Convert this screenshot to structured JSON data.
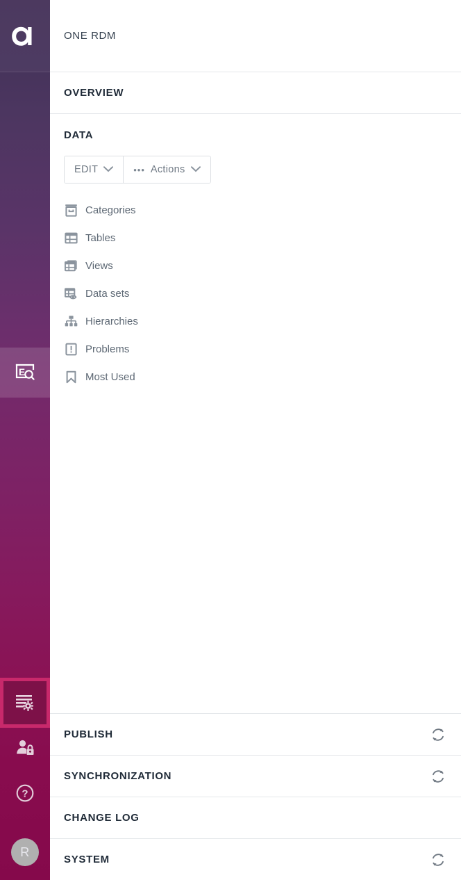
{
  "app": {
    "title": "ONE RDM",
    "logo_icon": "letter-a-logo"
  },
  "colors": {
    "rail_top": "#443158",
    "rail_bottom": "#85094b",
    "accent_pink": "#c8296b",
    "section_text": "#1f2a37",
    "menu_text": "#5d6874",
    "icon_gray": "#8a939d",
    "border": "#e4e7ea"
  },
  "rail": {
    "items": [
      {
        "name": "eq-search-icon",
        "label": "EQ",
        "state": "highlighted"
      },
      {
        "name": "data-settings-icon",
        "label": "Data Management",
        "state": "active"
      },
      {
        "name": "user-lock-icon",
        "label": "Security",
        "state": "normal"
      },
      {
        "name": "help-circle-icon",
        "label": "Help",
        "state": "normal"
      }
    ],
    "avatar": {
      "initial": "R",
      "name": "user-avatar"
    }
  },
  "overview": {
    "label": "OVERVIEW"
  },
  "data_section": {
    "label": "DATA",
    "toolbar": {
      "edit_label": "EDIT",
      "actions_label": "Actions",
      "dots": "•••"
    },
    "items": [
      {
        "label": "Categories",
        "icon": "archive-box-icon"
      },
      {
        "label": "Tables",
        "icon": "table-grid-icon"
      },
      {
        "label": "Views",
        "icon": "table-views-icon"
      },
      {
        "label": "Data sets",
        "icon": "dataset-eye-icon"
      },
      {
        "label": "Hierarchies",
        "icon": "hierarchy-tree-icon"
      },
      {
        "label": "Problems",
        "icon": "alert-square-icon"
      },
      {
        "label": "Most Used",
        "icon": "bookmark-icon"
      }
    ]
  },
  "bottom_sections": [
    {
      "label": "PUBLISH",
      "has_refresh": true
    },
    {
      "label": "SYNCHRONIZATION",
      "has_refresh": true
    },
    {
      "label": "CHANGE LOG",
      "has_refresh": false
    },
    {
      "label": "SYSTEM",
      "has_refresh": true
    }
  ]
}
